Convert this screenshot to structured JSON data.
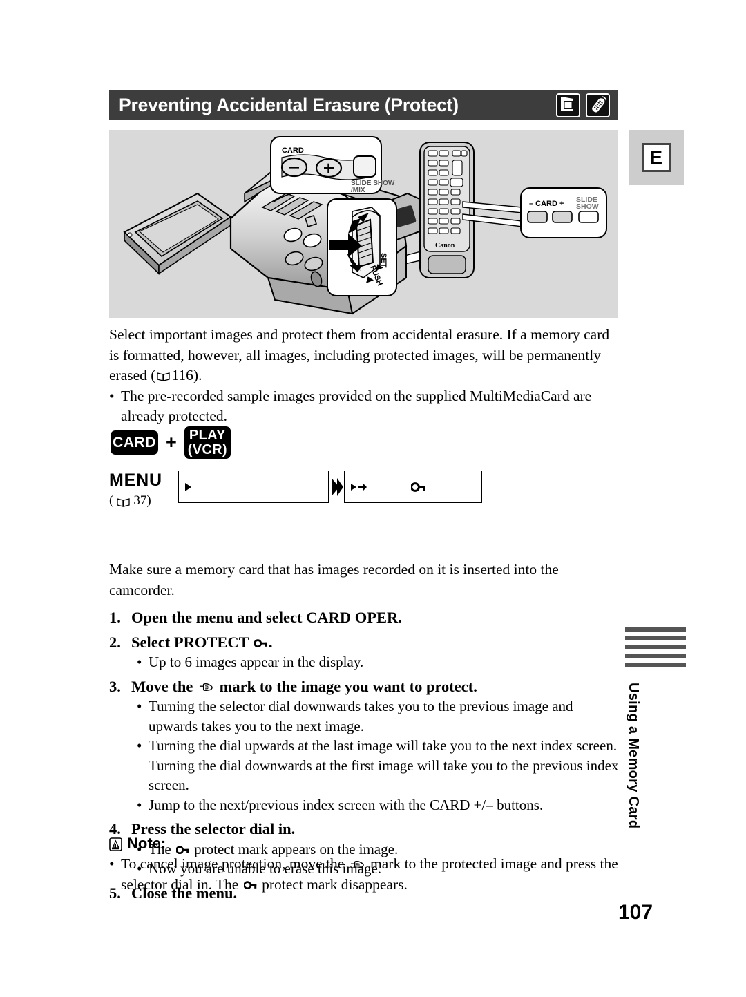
{
  "header": {
    "title": "Preventing Accidental Erasure (Protect)",
    "icons": [
      "card-photo-icon",
      "remote-control-icon"
    ]
  },
  "lang_badge": "E",
  "illustration": {
    "camcorder_callout": {
      "card_label": "CARD",
      "minus_label": "–",
      "plus_label": "+",
      "slide_show_line1": "SLIDE SHOW",
      "slide_show_line2": "/MIX"
    },
    "dial_callout": {
      "set_label": "SET",
      "push_label": "PUSH"
    },
    "remote": {
      "brand": "Canon",
      "callout": {
        "minus_label": "–",
        "card_label": "CARD",
        "plus_label": "+",
        "slide_line1": "SLIDE",
        "slide_line2": "SHOW"
      }
    }
  },
  "intro": {
    "paragraph": "Select important images and protect them from accidental erasure. If a memory card is formatted, however, all images, including protected images, will be permanently erased (",
    "paragraph_ref": "116",
    "paragraph_end": ").",
    "bullet": "The pre-recorded sample images provided on the supplied MultiMediaCard are already protected."
  },
  "modes": {
    "card": "CARD",
    "plus": "+",
    "play_line1": "PLAY",
    "play_line2": "(VCR)"
  },
  "menu": {
    "label": "MENU",
    "ref_open": "(",
    "ref_page": "37)",
    "box1_text": "",
    "box2_text": ""
  },
  "precondition": "Make sure a memory card that has images recorded on it is inserted into the camcorder.",
  "steps": [
    {
      "num": "1.",
      "title_before": "Open the menu and select CARD OPER.",
      "title_after": "",
      "icon": "",
      "bullets": []
    },
    {
      "num": "2.",
      "title_before": "Select PROTECT ",
      "title_after": ".",
      "icon": "key-icon",
      "bullets": [
        "Up to 6 images appear in the display."
      ]
    },
    {
      "num": "3.",
      "title_before": "Move the ",
      "title_after": " mark to the image you want to protect.",
      "icon": "pointing-hand-icon",
      "bullets": [
        "Turning the selector dial downwards takes you to the previous image and upwards takes you to the next image.",
        "Turning the dial upwards at the last image will take you to the next index screen. Turning the dial downwards at the first image will take you to the previous index screen.",
        "Jump to the next/previous index screen with the CARD +/– buttons."
      ]
    },
    {
      "num": "4.",
      "title_before": "Press the selector dial in.",
      "title_after": "",
      "icon": "",
      "bullets": []
    },
    {
      "num": "5.",
      "title_before": "Close the menu.",
      "title_after": "",
      "icon": "",
      "bullets": []
    }
  ],
  "step4_bullets": {
    "b1_before": "The ",
    "b1_after": " protect mark appears on the image.",
    "b2": "Now you are unable to erase this image."
  },
  "note": {
    "label": "Note:",
    "text_before": "To cancel image protection, move the ",
    "text_mid": " mark to the protected image and press the selector dial in. The ",
    "text_after": " protect mark disappears."
  },
  "side_tab": {
    "label": "Using a Memory Card",
    "bar_count": 5
  },
  "page_number": "107",
  "colors": {
    "title_bar": "#3d3d3d",
    "illustration_bg": "#d9d9d9",
    "badge_bg": "#cdcdcd",
    "tab_bar": "#555555"
  }
}
